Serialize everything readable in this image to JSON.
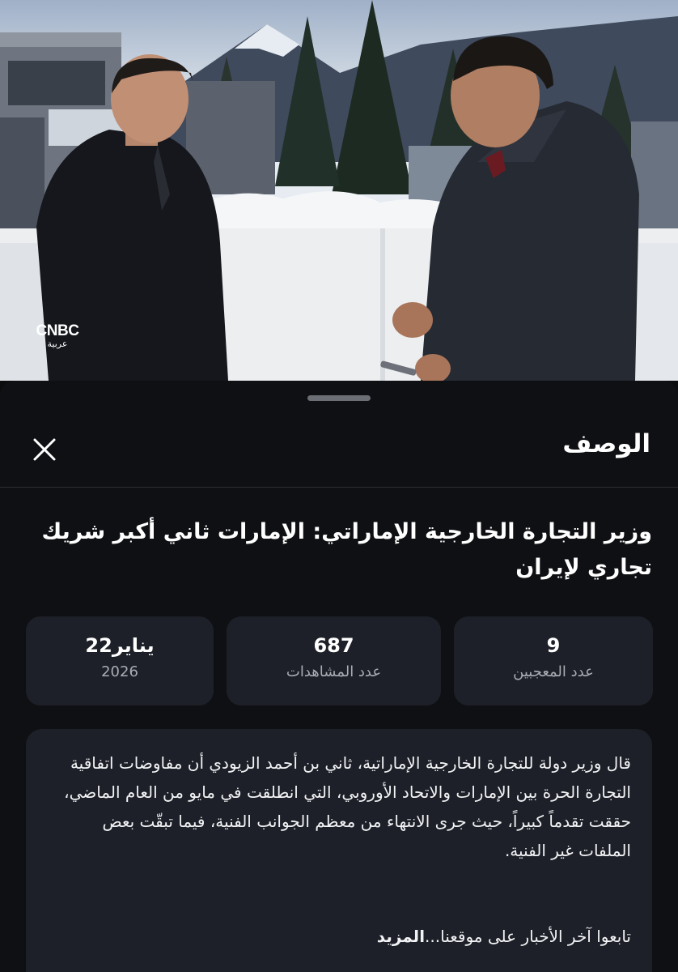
{
  "video": {
    "logo_text": "CNBC",
    "logo_subtext": "عربية"
  },
  "sheet": {
    "title": "الوصف",
    "close_icon": "close-icon",
    "headline": "وزير التجارة الخارجية الإماراتي: الإمارات ثاني أكبر شريك تجاري لإيران",
    "stats": {
      "likes": {
        "value": "9",
        "label": "عدد المعجبين"
      },
      "views": {
        "value": "687",
        "label": "عدد المشاهدات"
      },
      "date": {
        "value": "يناير22",
        "label": "2026"
      }
    },
    "description": {
      "body": "قال وزير دولة للتجارة الخارجية الإماراتية، ثاني بن أحمد الزيودي أن مفاوضات اتفاقية التجارة الحرة بين الإمارات والاتحاد الأوروبي، التي انطلقت في مايو من العام الماضي، حققت تقدماً كبيراً، حيث جرى الانتهاء من معظم الجوانب الفنية، فيما تبقّت بعض الملفات غير الفنية.",
      "footer_text": "تابعوا آخر الأخبار على موقعنا...",
      "more_label": "المزيد"
    }
  },
  "colors": {
    "sheet_bg": "#0f1013",
    "card_bg": "#1d2028",
    "muted_text": "#a9acb3"
  }
}
